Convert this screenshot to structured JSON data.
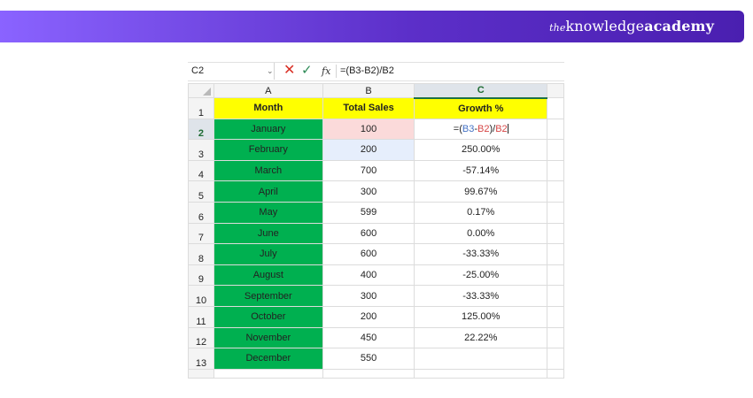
{
  "brand": {
    "prefix": "the",
    "knowledge": "knowledge",
    "academy": "academy"
  },
  "formula_bar": {
    "name_box": "C2",
    "fx_label": "fx",
    "formula": "=(B3-B2)/B2",
    "cancel_icon": "close-x-icon",
    "enter_icon": "check-icon"
  },
  "columns": [
    "A",
    "B",
    "C"
  ],
  "selected_column": "C",
  "selected_row": 2,
  "header_row": {
    "number": "1",
    "month": "Month",
    "total_sales": "Total Sales",
    "growth": "Growth %"
  },
  "editing_cell": {
    "prefix": "=(",
    "ref1": "B3",
    "minus": "-",
    "ref2": "B2",
    "mid": ")/",
    "ref3": "B2"
  },
  "rows": [
    {
      "number": "2",
      "month": "January",
      "sales": "100",
      "growth": ""
    },
    {
      "number": "3",
      "month": "February",
      "sales": "200",
      "growth": "250.00%"
    },
    {
      "number": "4",
      "month": "March",
      "sales": "700",
      "growth": "-57.14%"
    },
    {
      "number": "5",
      "month": "April",
      "sales": "300",
      "growth": "99.67%"
    },
    {
      "number": "6",
      "month": "May",
      "sales": "599",
      "growth": "0.17%"
    },
    {
      "number": "7",
      "month": "June",
      "sales": "600",
      "growth": "0.00%"
    },
    {
      "number": "8",
      "month": "July",
      "sales": "600",
      "growth": "-33.33%"
    },
    {
      "number": "9",
      "month": "August",
      "sales": "400",
      "growth": "-25.00%"
    },
    {
      "number": "10",
      "month": "September",
      "sales": "300",
      "growth": "-33.33%"
    },
    {
      "number": "11",
      "month": "October",
      "sales": "200",
      "growth": "125.00%"
    },
    {
      "number": "12",
      "month": "November",
      "sales": "450",
      "growth": "22.22%"
    },
    {
      "number": "13",
      "month": "December",
      "sales": "550",
      "growth": ""
    }
  ],
  "colors": {
    "header_fill": "#ffff00",
    "month_fill": "#00b050",
    "banner_start": "#8a63ff",
    "banner_end": "#4a1fb0",
    "ref_blue": "#4472c4",
    "ref_red": "#d64545"
  }
}
